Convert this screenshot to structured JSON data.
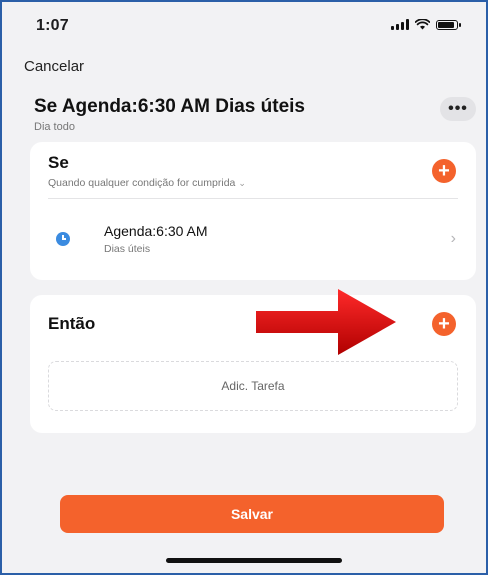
{
  "status": {
    "time": "1:07"
  },
  "header": {
    "cancel_label": "Cancelar",
    "title": "Se Agenda:6:30 AM Dias úteis",
    "subtitle": "Dia todo",
    "more_label": "•••"
  },
  "if_section": {
    "title": "Se",
    "condition_label": "Quando qualquer condição for cumprida",
    "condition_chevron": "⌄",
    "add_label": "+",
    "item": {
      "title": "Agenda:6:30 AM",
      "subtitle": "Dias úteis",
      "chevron": "›"
    }
  },
  "then_section": {
    "title": "Então",
    "add_label": "+",
    "add_task_label": "Adic. Tarefa"
  },
  "footer": {
    "save_label": "Salvar"
  },
  "colors": {
    "accent": "#f4622c",
    "clock": "#3b8be0",
    "arrow": "#d11616"
  },
  "icons": [
    "signal-icon",
    "wifi-icon",
    "battery-icon",
    "clock-icon",
    "red-arrow-icon"
  ]
}
